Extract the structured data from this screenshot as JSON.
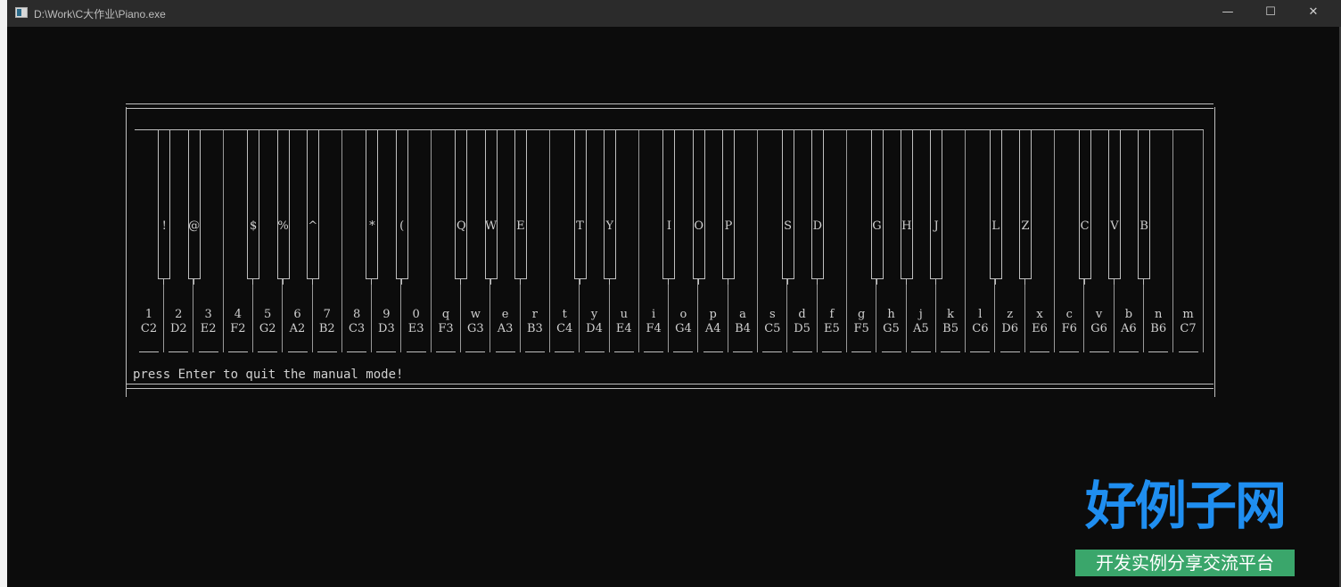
{
  "titlebar": {
    "title": "D:\\Work\\C大作业\\Piano.exe",
    "minimize": "—",
    "maximize": "☐",
    "close": "✕"
  },
  "piano": {
    "white_keys": [
      {
        "key": "1",
        "note": "C2"
      },
      {
        "key": "2",
        "note": "D2"
      },
      {
        "key": "3",
        "note": "E2"
      },
      {
        "key": "4",
        "note": "F2"
      },
      {
        "key": "5",
        "note": "G2"
      },
      {
        "key": "6",
        "note": "A2"
      },
      {
        "key": "7",
        "note": "B2"
      },
      {
        "key": "8",
        "note": "C3"
      },
      {
        "key": "9",
        "note": "D3"
      },
      {
        "key": "0",
        "note": "E3"
      },
      {
        "key": "q",
        "note": "F3"
      },
      {
        "key": "w",
        "note": "G3"
      },
      {
        "key": "e",
        "note": "A3"
      },
      {
        "key": "r",
        "note": "B3"
      },
      {
        "key": "t",
        "note": "C4"
      },
      {
        "key": "y",
        "note": "D4"
      },
      {
        "key": "u",
        "note": "E4"
      },
      {
        "key": "i",
        "note": "F4"
      },
      {
        "key": "o",
        "note": "G4"
      },
      {
        "key": "p",
        "note": "A4"
      },
      {
        "key": "a",
        "note": "B4"
      },
      {
        "key": "s",
        "note": "C5"
      },
      {
        "key": "d",
        "note": "D5"
      },
      {
        "key": "f",
        "note": "E5"
      },
      {
        "key": "g",
        "note": "F5"
      },
      {
        "key": "h",
        "note": "G5"
      },
      {
        "key": "j",
        "note": "A5"
      },
      {
        "key": "k",
        "note": "B5"
      },
      {
        "key": "l",
        "note": "C6"
      },
      {
        "key": "z",
        "note": "D6"
      },
      {
        "key": "x",
        "note": "E6"
      },
      {
        "key": "c",
        "note": "F6"
      },
      {
        "key": "v",
        "note": "G6"
      },
      {
        "key": "b",
        "note": "A6"
      },
      {
        "key": "n",
        "note": "B6"
      },
      {
        "key": "m",
        "note": "C7"
      }
    ],
    "black_keys": [
      {
        "key": "!",
        "after": 0
      },
      {
        "key": "@",
        "after": 1
      },
      {
        "key": "$",
        "after": 3
      },
      {
        "key": "%",
        "after": 4
      },
      {
        "key": "^",
        "after": 5
      },
      {
        "key": "*",
        "after": 7
      },
      {
        "key": "(",
        "after": 8
      },
      {
        "key": "Q",
        "after": 10
      },
      {
        "key": "W",
        "after": 11
      },
      {
        "key": "E",
        "after": 12
      },
      {
        "key": "T",
        "after": 14
      },
      {
        "key": "Y",
        "after": 15
      },
      {
        "key": "I",
        "after": 17
      },
      {
        "key": "O",
        "after": 18
      },
      {
        "key": "P",
        "after": 19
      },
      {
        "key": "S",
        "after": 21
      },
      {
        "key": "D",
        "after": 22
      },
      {
        "key": "G",
        "after": 24
      },
      {
        "key": "H",
        "after": 25
      },
      {
        "key": "J",
        "after": 26
      },
      {
        "key": "L",
        "after": 28
      },
      {
        "key": "Z",
        "after": 29
      },
      {
        "key": "C",
        "after": 31
      },
      {
        "key": "V",
        "after": 32
      },
      {
        "key": "B",
        "after": 33
      }
    ]
  },
  "console": {
    "prompt": "press Enter to quit the manual mode!"
  },
  "watermark": {
    "logo": "好例子网",
    "slogan": "开发实例分享交流平台"
  }
}
